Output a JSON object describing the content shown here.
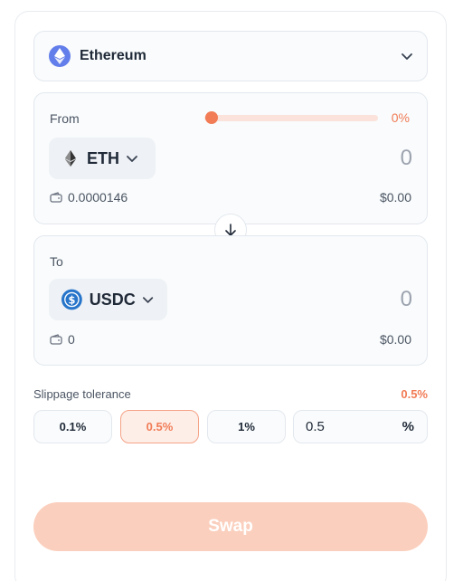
{
  "network": {
    "label": "Ethereum",
    "icon": "ethereum-logo-icon"
  },
  "from": {
    "title": "From",
    "percent": "0%",
    "slider_fraction": 0,
    "token": {
      "symbol": "ETH",
      "icon": "ethereum-icon"
    },
    "amount": "0",
    "balance": "0.0000146",
    "usd": "$0.00"
  },
  "to": {
    "title": "To",
    "token": {
      "symbol": "USDC",
      "icon": "usdc-icon"
    },
    "amount": "0",
    "balance": "0",
    "usd": "$0.00"
  },
  "slippage": {
    "label": "Slippage tolerance",
    "value": "0.5%",
    "options": [
      "0.1%",
      "0.5%",
      "1%"
    ],
    "selected": "0.5%",
    "custom_value": "0.5",
    "unit": "%"
  },
  "swap_button": {
    "label": "Swap"
  },
  "colors": {
    "accent": "#f17c56",
    "swap_disabled": "#fbcfbd",
    "eth_blue": "#627eea",
    "usdc_blue": "#2775ca"
  }
}
